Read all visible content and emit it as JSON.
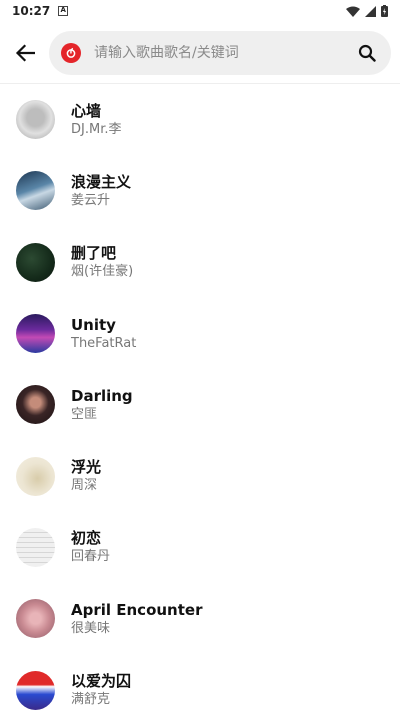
{
  "status": {
    "time": "10:27"
  },
  "search": {
    "placeholder": "请输入歌曲歌名/关键词",
    "value": ""
  },
  "colors": {
    "brand": "#e4252a",
    "search_bg": "#efefef",
    "artist_text": "#777777"
  },
  "songs": [
    {
      "title": "心墙",
      "artist": "DJ.Mr.李"
    },
    {
      "title": "浪漫主义",
      "artist": "姜云升"
    },
    {
      "title": "删了吧",
      "artist": "烟(许佳豪)"
    },
    {
      "title": "Unity",
      "artist": "TheFatRat"
    },
    {
      "title": "Darling",
      "artist": "空匪"
    },
    {
      "title": "浮光",
      "artist": "周深"
    },
    {
      "title": "初恋",
      "artist": "回春丹"
    },
    {
      "title": "April Encounter",
      "artist": "很美味"
    },
    {
      "title": "以爱为囚",
      "artist": "满舒克"
    }
  ]
}
